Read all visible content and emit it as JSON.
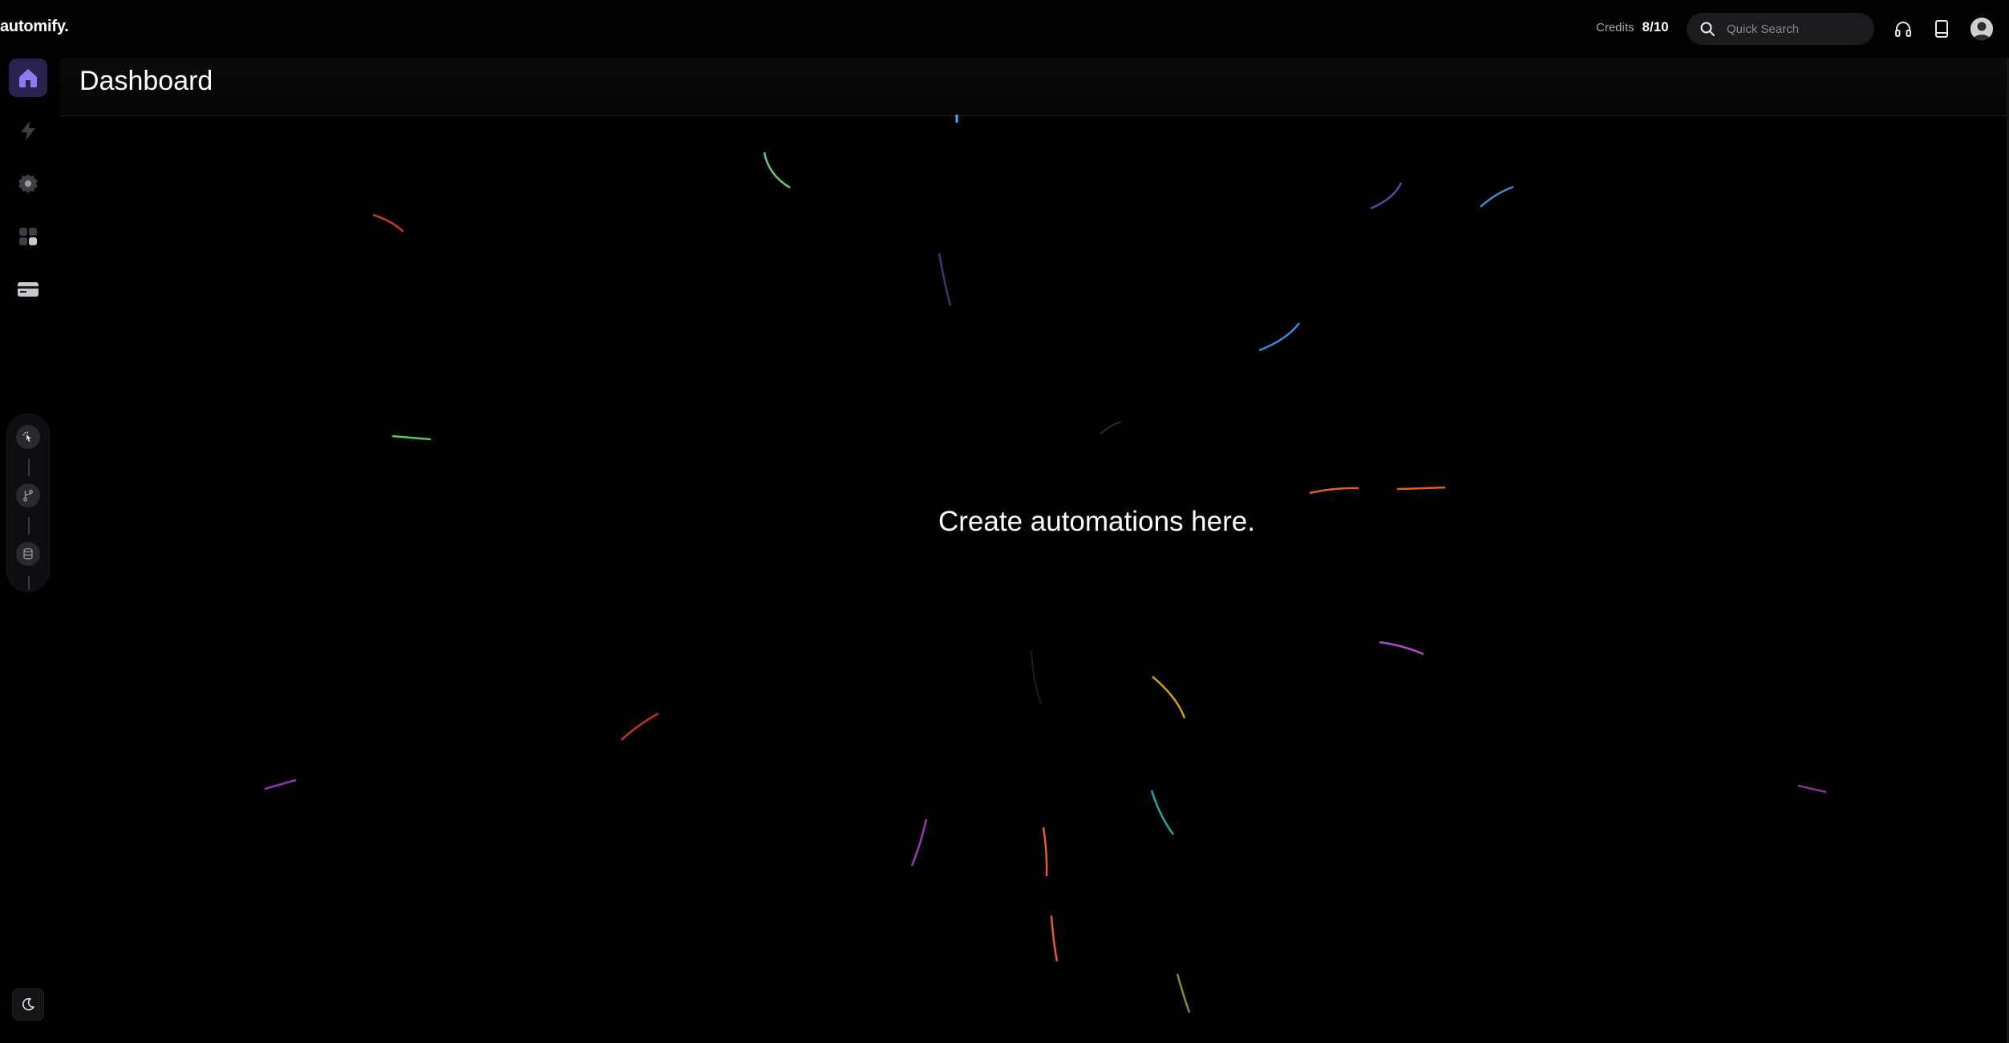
{
  "app": {
    "brand": "automify."
  },
  "topbar": {
    "credits_label": "Credits",
    "credits_value": "8/10",
    "search_placeholder": "Quick Search"
  },
  "page": {
    "title": "Dashboard",
    "empty_message": "Create automations here."
  },
  "sidebar": {
    "items": [
      {
        "icon": "home-icon",
        "active": true
      },
      {
        "icon": "lightning-icon",
        "active": false
      },
      {
        "icon": "gear-icon",
        "active": false
      },
      {
        "icon": "apps-icon",
        "active": false
      },
      {
        "icon": "credit-card-icon",
        "active": false
      }
    ],
    "workflow_steps": [
      "trigger-icon",
      "branch-icon",
      "database-icon"
    ],
    "theme_toggle_icon": "moon-icon"
  },
  "colors": {
    "accent": "#2a2350",
    "accent_icon": "#8b7cf6",
    "background": "#000000"
  }
}
